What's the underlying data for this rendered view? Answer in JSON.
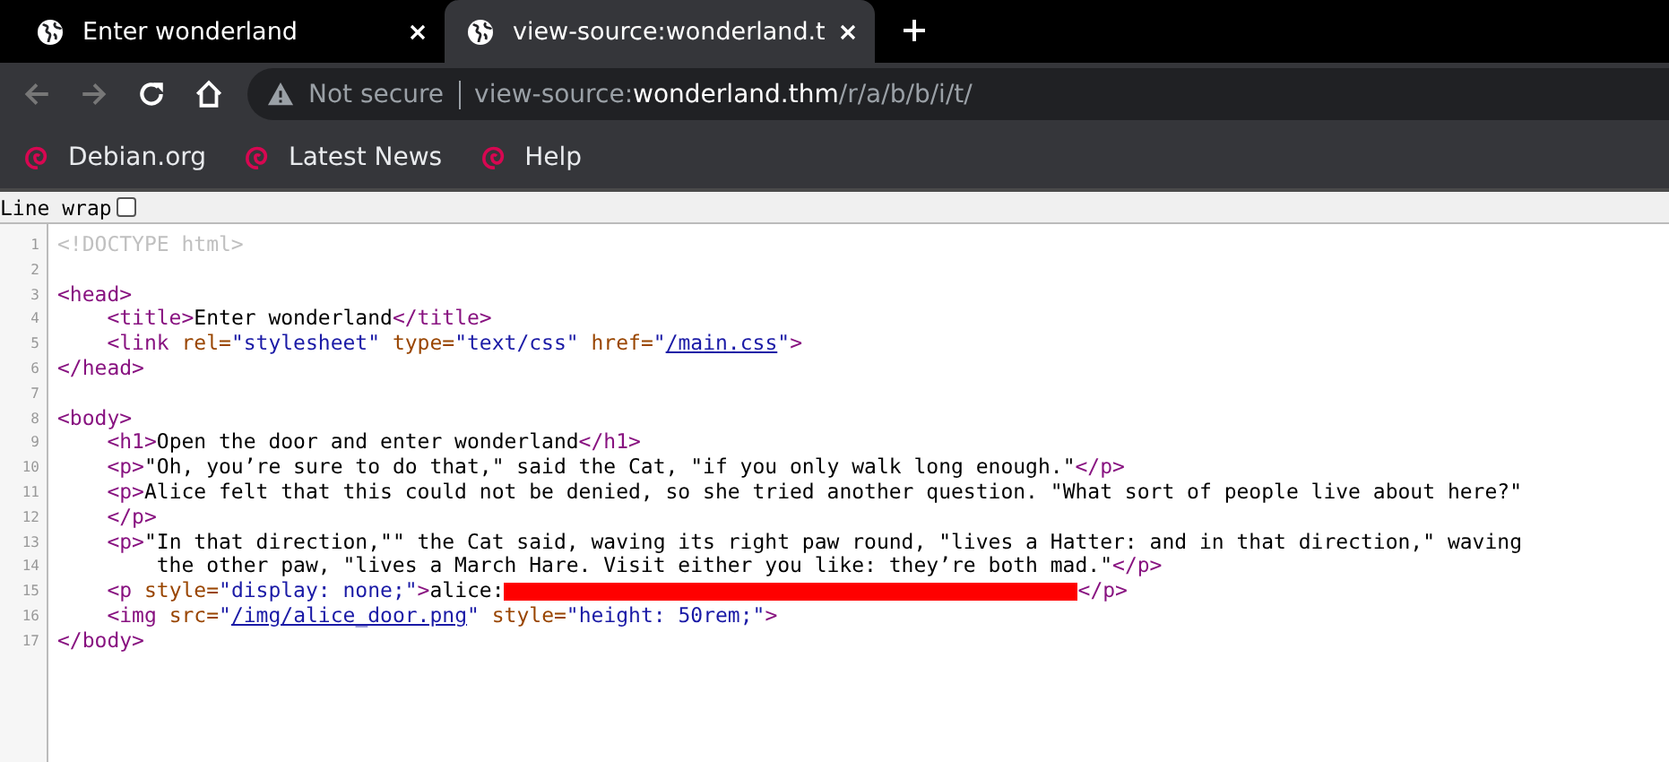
{
  "tabs": [
    {
      "title": "Enter wonderland",
      "selected": false
    },
    {
      "title": "view-source:wonderland.t",
      "selected": true
    }
  ],
  "toolbar": {
    "forward_disabled": true,
    "security": "Not secure",
    "url": {
      "scheme": "view-source:",
      "host": "wonderland.thm",
      "path": "/r/a/b/b/i/t/"
    }
  },
  "bookmarks": [
    "Debian.org",
    "Latest News",
    "Help"
  ],
  "line_wrap": {
    "label": "Line wrap",
    "checked": false
  },
  "source_lines": [
    {
      "number": "1",
      "tokens": [
        {
          "kind": "doctype",
          "text": "<!DOCTYPE html>"
        }
      ]
    },
    {
      "number": "2"
    },
    {
      "number": "3",
      "tokens": [
        {
          "kind": "tag",
          "text": "<head>"
        }
      ]
    },
    {
      "number": "4",
      "tokens": [
        {
          "kind": "tag",
          "text": "    <title>"
        },
        {
          "kind": "text",
          "text": "Enter wonderland"
        },
        {
          "kind": "tag",
          "text": "</title>"
        }
      ]
    },
    {
      "number": "5",
      "tokens": [
        {
          "kind": "tag",
          "text": "    <link"
        },
        {
          "kind": "attr",
          "text": " rel="
        },
        {
          "kind": "value",
          "text": "\"stylesheet\""
        },
        {
          "kind": "attr",
          "text": " type="
        },
        {
          "kind": "value",
          "text": "\"text/css\""
        },
        {
          "kind": "attr",
          "text": " href="
        },
        {
          "kind": "value",
          "text": "\""
        },
        {
          "kind": "link",
          "text": "/main.css"
        },
        {
          "kind": "value",
          "text": "\""
        },
        {
          "kind": "tag",
          "text": ">"
        }
      ]
    },
    {
      "number": "6",
      "tokens": [
        {
          "kind": "tag",
          "text": "</head>"
        }
      ]
    },
    {
      "number": "7"
    },
    {
      "number": "8",
      "tokens": [
        {
          "kind": "tag",
          "text": "<body>"
        }
      ]
    },
    {
      "number": "9",
      "tokens": [
        {
          "kind": "tag",
          "text": "    <h1>"
        },
        {
          "kind": "text",
          "text": "Open the door and enter wonderland"
        },
        {
          "kind": "tag",
          "text": "</h1>"
        }
      ]
    },
    {
      "number": "10",
      "tokens": [
        {
          "kind": "tag",
          "text": "    <p>"
        },
        {
          "kind": "text",
          "text": "\"Oh, you’re sure to do that,\" said the Cat, \"if you only walk long enough.\""
        },
        {
          "kind": "tag",
          "text": "</p>"
        }
      ]
    },
    {
      "number": "11",
      "tokens": [
        {
          "kind": "tag",
          "text": "    <p>"
        },
        {
          "kind": "text",
          "text": "Alice felt that this could not be denied, so she tried another question. \"What sort of people live about here?\""
        }
      ]
    },
    {
      "number": "12",
      "tokens": [
        {
          "kind": "tag",
          "text": "    </p>"
        }
      ]
    },
    {
      "number": "13",
      "tokens": [
        {
          "kind": "tag",
          "text": "    <p>"
        },
        {
          "kind": "text",
          "text": "\"In that direction,\"\" the Cat said, waving its right paw round, \"lives a Hatter: and in that direction,\" waving"
        }
      ]
    },
    {
      "number": "14",
      "tokens": [
        {
          "kind": "text",
          "text": "        the other paw, \"lives a March Hare. Visit either you like: they’re both mad.\""
        },
        {
          "kind": "tag",
          "text": "</p>"
        }
      ]
    },
    {
      "number": "15",
      "tokens": [
        {
          "kind": "tag",
          "text": "    <p"
        },
        {
          "kind": "attr",
          "text": " style="
        },
        {
          "kind": "value",
          "text": "\"display: none;\""
        },
        {
          "kind": "tag",
          "text": ">"
        },
        {
          "kind": "text",
          "text": "alice:"
        },
        {
          "kind": "redacted"
        },
        {
          "kind": "tag",
          "text": "</p>"
        }
      ]
    },
    {
      "number": "16",
      "tokens": [
        {
          "kind": "tag",
          "text": "    <img"
        },
        {
          "kind": "attr",
          "text": " src="
        },
        {
          "kind": "value",
          "text": "\""
        },
        {
          "kind": "link",
          "text": "/img/alice_door.png"
        },
        {
          "kind": "value",
          "text": "\""
        },
        {
          "kind": "attr",
          "text": " style="
        },
        {
          "kind": "value",
          "text": "\"height: 50rem;\""
        },
        {
          "kind": "tag",
          "text": ">"
        }
      ]
    },
    {
      "number": "17",
      "tokens": [
        {
          "kind": "tag",
          "text": "</body>"
        }
      ]
    }
  ]
}
